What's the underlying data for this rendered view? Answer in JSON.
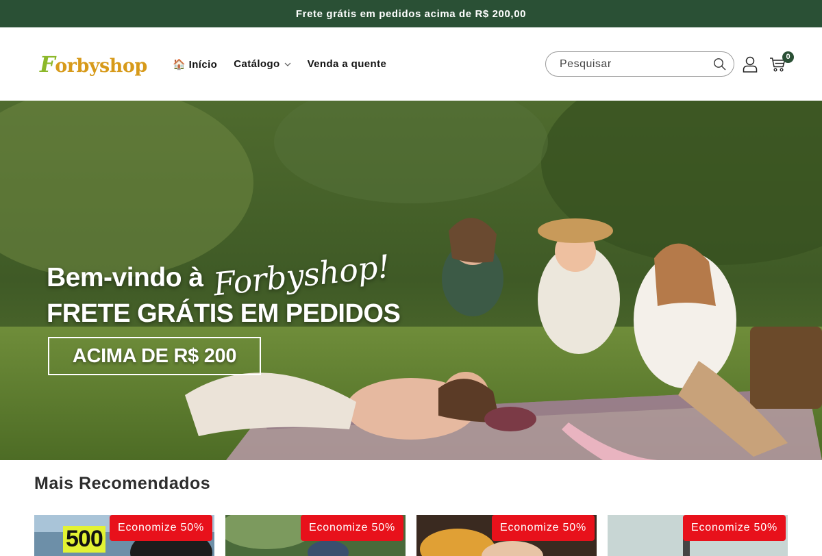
{
  "announcement": {
    "text": "Frete grátis em pedidos acima de R$ 200,00"
  },
  "header": {
    "logo": {
      "first_letter": "F",
      "rest": "orbyshop"
    },
    "nav": [
      {
        "label": "🏠 Início"
      },
      {
        "label": "Catálogo",
        "has_dropdown": true
      },
      {
        "label": "Venda a quente"
      }
    ],
    "search": {
      "placeholder": "Pesquisar",
      "icon": "search-icon"
    },
    "account_icon": "user-icon",
    "cart": {
      "icon": "cart-icon",
      "count": "0"
    }
  },
  "hero": {
    "welcome": "Bem-vindo à",
    "brand_script": "Forbyshop!",
    "line2": "FRETE GRÁTIS EM PEDIDOS",
    "box_text": "ACIMA DE R$ 200"
  },
  "recommended": {
    "title": "Mais Recomendados",
    "products": [
      {
        "badge": "Economize 50%",
        "thumb_text": "500"
      },
      {
        "badge": "Economize 50%"
      },
      {
        "badge": "Economize 50%"
      },
      {
        "badge": "Economize 50%"
      }
    ]
  },
  "colors": {
    "announcement_bg": "#2a5035",
    "badge_bg": "#e8111b",
    "logo_green": "#8cb82a",
    "logo_gold": "#d79a1a"
  }
}
